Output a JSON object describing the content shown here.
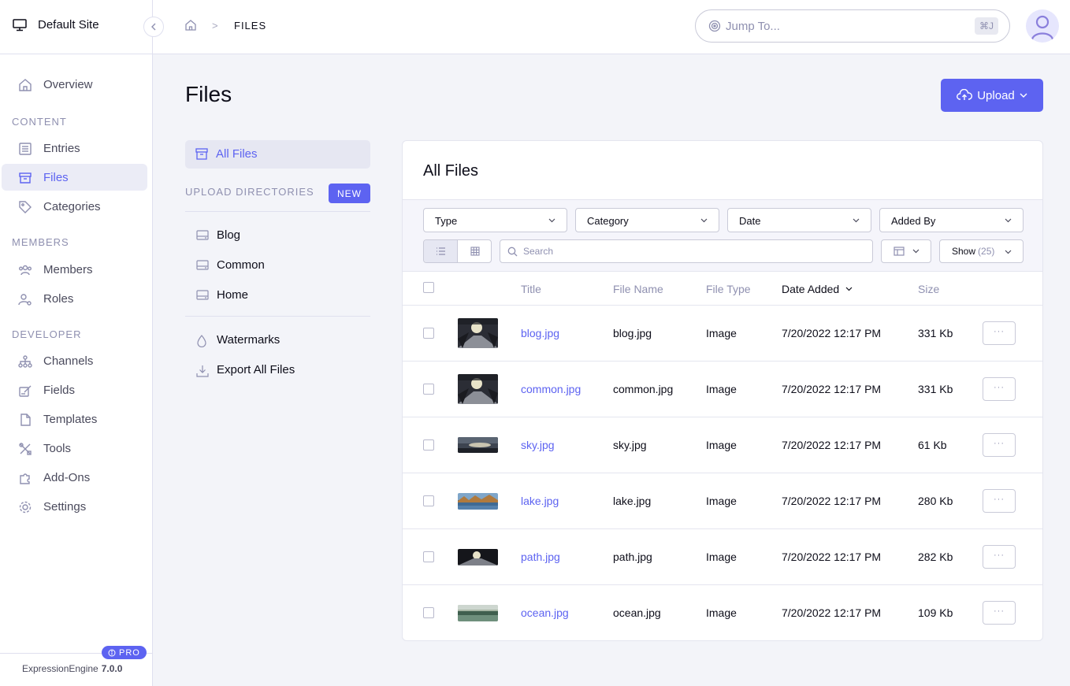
{
  "site": {
    "name": "Default Site"
  },
  "nav": {
    "overview": "Overview",
    "content_section": "CONTENT",
    "entries": "Entries",
    "files": "Files",
    "categories": "Categories",
    "members_section": "MEMBERS",
    "members": "Members",
    "roles": "Roles",
    "developer_section": "DEVELOPER",
    "channels": "Channels",
    "fields": "Fields",
    "templates": "Templates",
    "tools": "Tools",
    "addons": "Add-Ons",
    "settings": "Settings"
  },
  "footer": {
    "pro_badge": "PRO",
    "product": "ExpressionEngine",
    "version": "7.0.0"
  },
  "breadcrumb": {
    "separator": ">",
    "current": "FILES"
  },
  "jump": {
    "placeholder": "Jump To...",
    "shortcut": "⌘J"
  },
  "page": {
    "title": "Files",
    "upload_label": "Upload"
  },
  "dirs": {
    "all_files": "All Files",
    "upload_directories_label": "UPLOAD DIRECTORIES",
    "new_label": "NEW",
    "items": [
      "Blog",
      "Common",
      "Home"
    ],
    "watermarks": "Watermarks",
    "export": "Export All Files"
  },
  "panel": {
    "title": "All Files",
    "filters": {
      "type": "Type",
      "category": "Category",
      "date": "Date",
      "added_by": "Added By"
    },
    "search_placeholder": "Search",
    "show_label": "Show",
    "show_count": "(25)"
  },
  "table": {
    "columns": {
      "title": "Title",
      "file_name": "File Name",
      "file_type": "File Type",
      "date_added": "Date Added",
      "size": "Size"
    },
    "more_label": "···",
    "rows": [
      {
        "title": "blog.jpg",
        "file_name": "blog.jpg",
        "file_type": "Image",
        "date_added": "7/20/2022 12:17 PM",
        "size": "331 Kb"
      },
      {
        "title": "common.jpg",
        "file_name": "common.jpg",
        "file_type": "Image",
        "date_added": "7/20/2022 12:17 PM",
        "size": "331 Kb"
      },
      {
        "title": "sky.jpg",
        "file_name": "sky.jpg",
        "file_type": "Image",
        "date_added": "7/20/2022 12:17 PM",
        "size": "61 Kb"
      },
      {
        "title": "lake.jpg",
        "file_name": "lake.jpg",
        "file_type": "Image",
        "date_added": "7/20/2022 12:17 PM",
        "size": "280 Kb"
      },
      {
        "title": "path.jpg",
        "file_name": "path.jpg",
        "file_type": "Image",
        "date_added": "7/20/2022 12:17 PM",
        "size": "282 Kb"
      },
      {
        "title": "ocean.jpg",
        "file_name": "ocean.jpg",
        "file_type": "Image",
        "date_added": "7/20/2022 12:17 PM",
        "size": "109 Kb"
      }
    ]
  },
  "colors": {
    "accent": "#5d63f1",
    "muted_text": "#8f90b0",
    "background": "#f3f4f9"
  }
}
